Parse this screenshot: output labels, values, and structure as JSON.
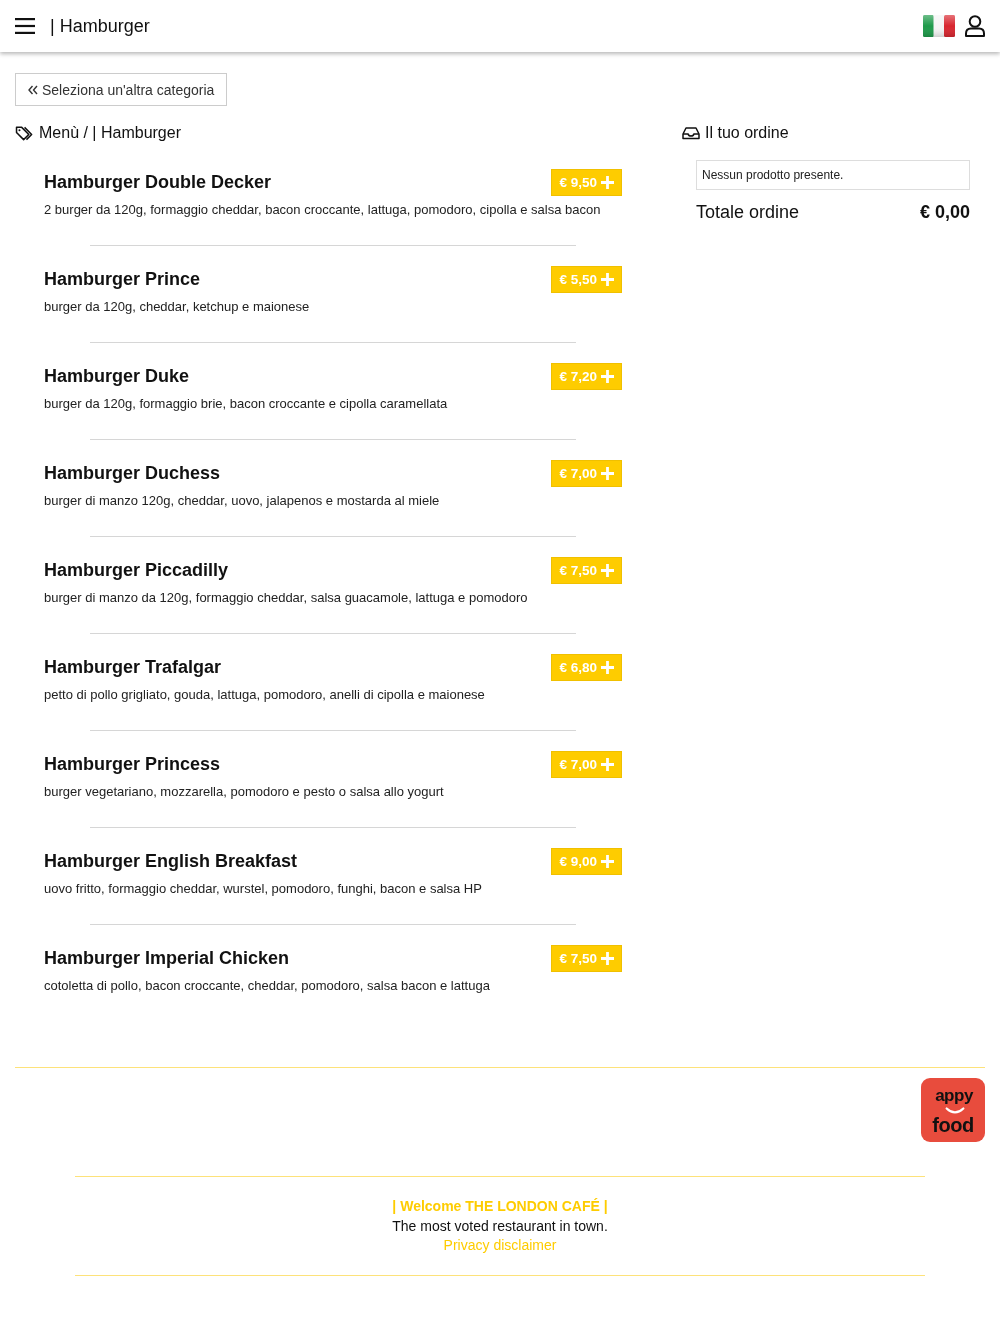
{
  "header": {
    "title": "| Hamburger"
  },
  "back_button": {
    "label": "Seleziona un'altra categoria"
  },
  "breadcrumb": {
    "text": "Menù / | Hamburger"
  },
  "menu_items": [
    {
      "name": "Hamburger Double Decker",
      "description": "2 burger da 120g, formaggio cheddar, bacon croccante, lattuga, pomodoro, cipolla e salsa bacon",
      "price": "€ 9,50"
    },
    {
      "name": "Hamburger Prince",
      "description": "burger da 120g, cheddar, ketchup e maionese",
      "price": "€ 5,50"
    },
    {
      "name": "Hamburger Duke",
      "description": "burger da 120g, formaggio brie, bacon croccante e cipolla caramellata",
      "price": "€ 7,20"
    },
    {
      "name": "Hamburger Duchess",
      "description": "burger di manzo 120g, cheddar, uovo, jalapenos e mostarda al miele",
      "price": "€ 7,00"
    },
    {
      "name": "Hamburger Piccadilly",
      "description": "burger di manzo da 120g, formaggio cheddar, salsa guacamole, lattuga e pomodoro",
      "price": "€ 7,50"
    },
    {
      "name": "Hamburger Trafalgar",
      "description": "petto di pollo grigliato, gouda, lattuga, pomodoro, anelli di cipolla e maionese",
      "price": "€ 6,80"
    },
    {
      "name": "Hamburger Princess",
      "description": "burger vegetariano, mozzarella, pomodoro e pesto o salsa allo yogurt",
      "price": "€ 7,00"
    },
    {
      "name": "Hamburger English Breakfast",
      "description": "uovo fritto, formaggio cheddar, wurstel, pomodoro, funghi, bacon e salsa HP",
      "price": "€ 9,00"
    },
    {
      "name": "Hamburger Imperial Chicken",
      "description": "cotoletta di pollo, bacon croccante, cheddar, pomodoro, salsa bacon e lattuga",
      "price": "€ 7,50"
    }
  ],
  "order": {
    "title": "Il tuo ordine",
    "empty_message": "Nessun prodotto presente.",
    "total_label": "Totale ordine",
    "total_value": "€ 0,00"
  },
  "footer": {
    "logo": {
      "line_1": "appy",
      "line_2": "food"
    },
    "welcome": "| Welcome THE LONDON CAFÉ |",
    "tagline": "The most voted restaurant in town.",
    "privacy_link": "Privacy disclaimer"
  }
}
